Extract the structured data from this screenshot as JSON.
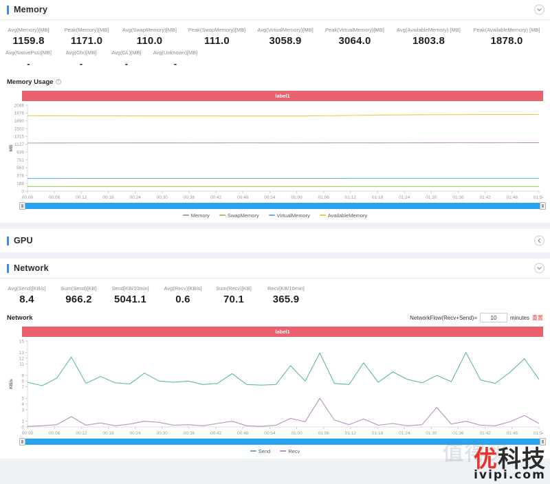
{
  "sections": {
    "memory": {
      "title": "Memory",
      "collapse_icon": "chevron-down-icon",
      "metrics_row1": [
        {
          "label": "Avg(Memory)[MB]",
          "value": "1159.8"
        },
        {
          "label": "Peak(Memory)[MB]",
          "value": "1171.0"
        },
        {
          "label": "Avg(SwapMemory)[MB]",
          "value": "110.0"
        },
        {
          "label": "Peak(SwapMemory)[MB]",
          "value": "111.0"
        },
        {
          "label": "Avg(VirtualMemory)[MB]",
          "value": "3058.9"
        },
        {
          "label": "Peak(VirtualMemory)[MB]",
          "value": "3064.0"
        },
        {
          "label": "Avg(AvailableMemory) [MB]",
          "value": "1803.8"
        },
        {
          "label": "Peak(AvailableMemory) [MB]",
          "value": "1878.0"
        }
      ],
      "metrics_row2": [
        {
          "label": "Avg(NativePss)[MB]",
          "value": "-"
        },
        {
          "label": "Avg(Gfx)[MB]",
          "value": "-"
        },
        {
          "label": "Avg(GL)[MB]",
          "value": "-"
        },
        {
          "label": "Avg(Unknown)[MB]",
          "value": "-"
        }
      ],
      "chart_title": "Memory Usage",
      "info_icon": "info-icon",
      "banner_label": "label1"
    },
    "gpu": {
      "title": "GPU",
      "collapse_icon": "chevron-left-icon"
    },
    "network": {
      "title": "Network",
      "collapse_icon": "chevron-down-icon",
      "metrics_row1": [
        {
          "label": "Avg(Send)[KB/s]",
          "value": "8.4"
        },
        {
          "label": "Sum(Send)[KB]",
          "value": "966.2"
        },
        {
          "label": "Send[KB/10min]",
          "value": "5041.1"
        },
        {
          "label": "Avg(Recv)[KB/s]",
          "value": "0.6"
        },
        {
          "label": "Sum(Recv)[KB]",
          "value": "70.1"
        },
        {
          "label": "Recv[KB/10min]",
          "value": "365.9"
        }
      ],
      "chart_title": "Network",
      "flow_label": "NetworkFlow(Recv+Send)=",
      "flow_value": "10",
      "flow_unit": "minutes",
      "reset_label": "重置",
      "banner_label": "label1"
    }
  },
  "slider": {
    "left_handle": "slider-handle-left",
    "right_handle": "slider-handle-right"
  },
  "watermark": {
    "cn_red": "优",
    "cn_dark": "科技",
    "url": "ivipi.com",
    "faint": "值得买"
  },
  "colors": {
    "accent": "#3a8ee6",
    "banner": "#e8616d",
    "slider": "#2aa3ef",
    "memory": "#b98ec0",
    "swap_memory": "#9fc95a",
    "virtual_memory": "#6ab0de",
    "available_memory": "#e8c84f",
    "send": "#5eb99f",
    "recv": "#b98ec0",
    "reset": "#e03b3b"
  },
  "chart_data": [
    {
      "type": "line",
      "title": "Memory Usage",
      "xlabel": "",
      "ylabel": "MB",
      "ylim": [
        0,
        2066
      ],
      "yticks": [
        0,
        188,
        376,
        563,
        751,
        939,
        1127,
        1315,
        1502,
        1690,
        1878,
        2066
      ],
      "grid": false,
      "legend_position": "bottom",
      "x": [
        "00:00",
        "00:06",
        "00:12",
        "00:18",
        "00:24",
        "00:30",
        "00:36",
        "00:42",
        "00:48",
        "00:54",
        "01:00",
        "01:06",
        "01:12",
        "01:18",
        "01:24",
        "01:30",
        "01:36",
        "01:42",
        "01:48",
        "01:54"
      ],
      "series": [
        {
          "name": "Memory",
          "color": "#b98ec0",
          "values": [
            1157,
            1158,
            1159,
            1159,
            1160,
            1160,
            1159,
            1160,
            1161,
            1160,
            1159,
            1160,
            1161,
            1160,
            1161,
            1162,
            1163,
            1162,
            1163,
            1164
          ]
        },
        {
          "name": "SwapMemory",
          "color": "#9fc95a",
          "values": [
            110,
            110,
            110,
            110,
            110,
            110,
            110,
            110,
            110,
            110,
            110,
            110,
            110,
            111,
            111,
            111,
            111,
            111,
            111,
            111
          ]
        },
        {
          "name": "VirtualMemory",
          "color": "#6ab0de",
          "values": [
            305,
            305,
            306,
            306,
            306,
            306,
            306,
            306,
            306,
            306,
            306,
            306,
            307,
            307,
            307,
            307,
            307,
            307,
            307,
            307
          ]
        },
        {
          "name": "AvailableMemory",
          "color": "#e8c84f",
          "values": [
            1812,
            1811,
            1810,
            1810,
            1809,
            1809,
            1808,
            1808,
            1807,
            1807,
            1806,
            1812,
            1820,
            1828,
            1834,
            1838,
            1840,
            1841,
            1842,
            1843
          ]
        }
      ]
    },
    {
      "type": "line",
      "title": "Network",
      "xlabel": "",
      "ylabel": "KB/s",
      "ylim": [
        0,
        15
      ],
      "yticks": [
        0,
        1,
        3,
        4,
        5,
        7,
        8,
        9,
        11,
        12,
        13,
        15
      ],
      "grid": false,
      "legend_position": "bottom",
      "x": [
        "00:00",
        "00:06",
        "00:12",
        "00:18",
        "00:24",
        "00:30",
        "00:36",
        "00:42",
        "00:48",
        "00:54",
        "01:00",
        "01:06",
        "01:12",
        "01:18",
        "01:24",
        "01:30",
        "01:36",
        "01:42",
        "01:48",
        "01:54"
      ],
      "series": [
        {
          "name": "Send",
          "color": "#5eb99f",
          "values": [
            7.8,
            7.2,
            8.5,
            12.2,
            7.6,
            8.8,
            7.7,
            7.5,
            9.4,
            8.0,
            7.8,
            8.0,
            7.4,
            7.6,
            9.3,
            7.4,
            7.3,
            7.4,
            10.7,
            8.0,
            12.9,
            7.6,
            7.4,
            11.2,
            7.8,
            9.6,
            8.3,
            7.7,
            9.0,
            7.9,
            13.0,
            8.2,
            7.6,
            9.5,
            11.9,
            8.3
          ]
        },
        {
          "name": "Recv",
          "color": "#b98ec0",
          "values": [
            0.1,
            0.2,
            0.4,
            1.8,
            0.3,
            0.7,
            0.2,
            0.5,
            1.0,
            0.8,
            0.3,
            0.4,
            0.2,
            0.6,
            1.0,
            0.2,
            0.1,
            0.3,
            1.5,
            0.9,
            5.0,
            1.2,
            0.4,
            1.4,
            0.3,
            0.6,
            0.2,
            0.4,
            3.4,
            0.5,
            1.0,
            0.3,
            0.2,
            0.9,
            2.0,
            0.6
          ]
        }
      ]
    }
  ]
}
